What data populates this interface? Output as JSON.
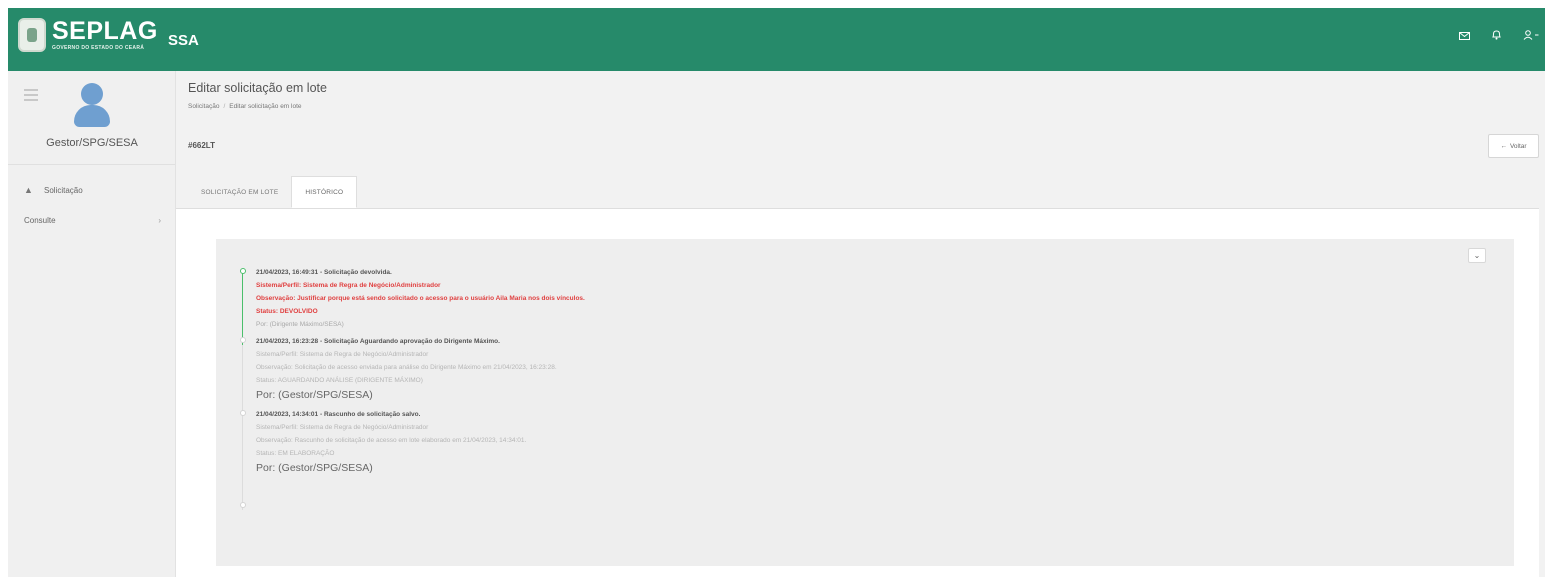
{
  "header": {
    "brand": "SEPLAG",
    "brand_sub": "GOVERNO DO ESTADO DO CEARÁ",
    "app_name": "SSA",
    "icons": [
      "mail-icon",
      "bell-icon",
      "user-menu-icon"
    ],
    "accent": "#268a6a"
  },
  "sidebar": {
    "profile_name": "Gestor/SPG/SESA",
    "items": [
      {
        "label": "Solicitação",
        "icon": "warning-icon"
      },
      {
        "label": "Consulte",
        "icon": "chevron-right-icon"
      }
    ]
  },
  "page": {
    "title": "Editar solicitação em lote",
    "breadcrumb": [
      "Solicitação",
      "Editar solicitação em lote"
    ],
    "code": "#662LT",
    "back_label": "Voltar"
  },
  "tabs": [
    {
      "label": "SOLICITAÇÃO EM LOTE",
      "active": false
    },
    {
      "label": "HISTÓRICO",
      "active": true
    }
  ],
  "history": [
    {
      "title": "21/04/2023, 16:49:31 - Solicitação devolvida.",
      "perfil": "Sistema/Perfil: Sistema de Regra de Negócio/Administrador",
      "observacao": "Observação: Justificar porque está sendo solicitado o acesso para o usuário Aila Maria nos dois vínculos.",
      "status": "Status: DEVOLVIDO",
      "por": "Por: (Dirigente Máximo/SESA)"
    },
    {
      "title": "21/04/2023, 16:23:28 - Solicitação Aguardando aprovação do Dirigente Máximo.",
      "perfil": "Sistema/Perfil: Sistema de Regra de Negócio/Administrador",
      "observacao": "Observação: Solicitação de acesso enviada para análise do Dirigente Máximo em 21/04/2023, 16:23:28.",
      "status": "Status: AGUARDANDO ANÁLISE (DIRIGENTE MÁXIMO)",
      "por": "Por: (Gestor/SPG/SESA)"
    },
    {
      "title": "21/04/2023, 14:34:01 - Rascunho de solicitação salvo.",
      "perfil": "Sistema/Perfil: Sistema de Regra de Negócio/Administrador",
      "observacao": "Observação: Rascunho de solicitação de acesso em lote elaborado em 21/04/2023, 14:34:01.",
      "status": "Status: EM ELABORAÇÃO",
      "por": "Por: (Gestor/SPG/SESA)"
    }
  ]
}
